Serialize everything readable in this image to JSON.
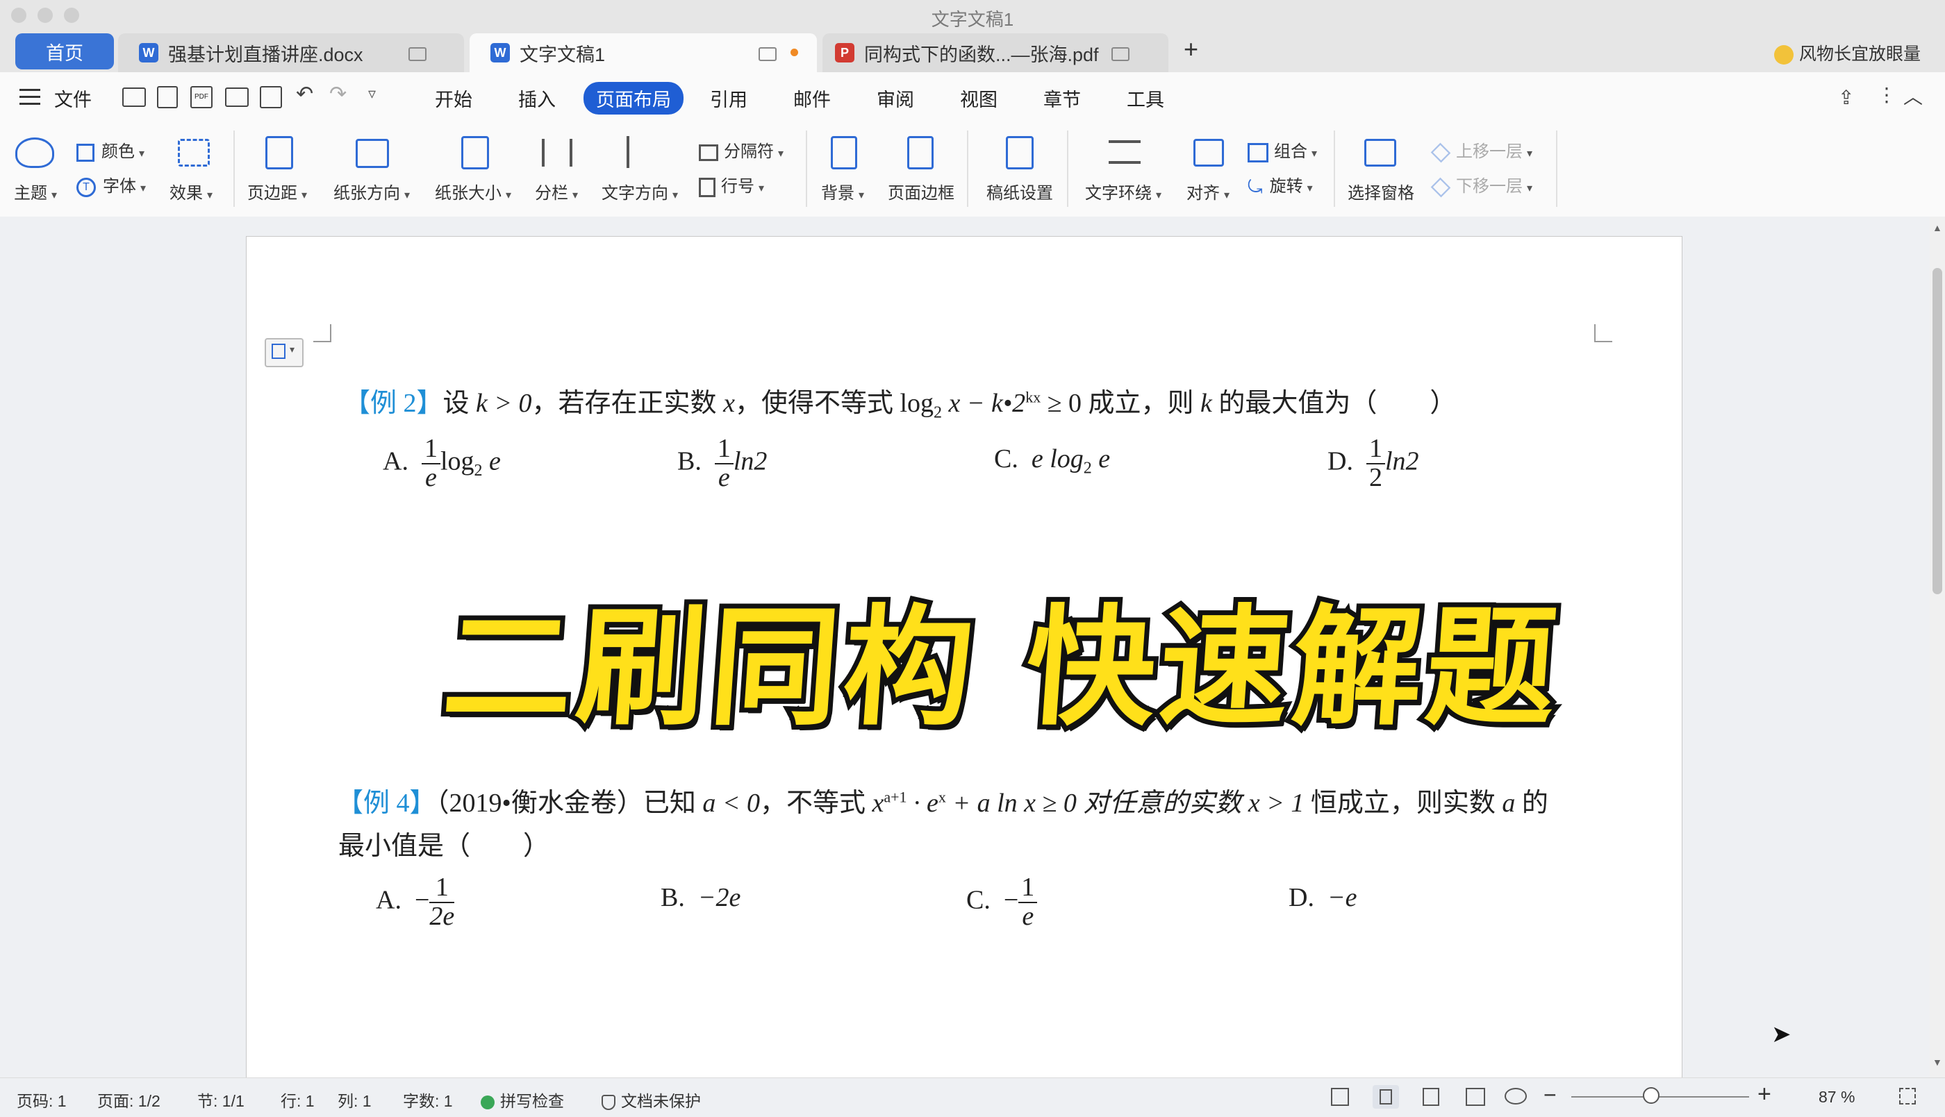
{
  "window": {
    "title": "文字文稿1"
  },
  "tabs": {
    "home": "首页",
    "tab1": "强基计划直播讲座.docx",
    "tab2": "文字文稿1",
    "tab3": "同构式下的函数...—张海.pdf",
    "new_tab": "+",
    "promo": "风物长宜放眼量"
  },
  "menu": {
    "file": "文件",
    "items": [
      "开始",
      "插入",
      "页面布局",
      "引用",
      "邮件",
      "审阅",
      "视图",
      "章节",
      "工具"
    ],
    "active": "页面布局"
  },
  "ribbon": {
    "theme": "主题",
    "color": "颜色",
    "font": "字体",
    "effect": "效果",
    "margins": "页边距",
    "orientation": "纸张方向",
    "size": "纸张大小",
    "columns": "分栏",
    "text_direction": "文字方向",
    "separator": "分隔符",
    "line_number": "行号",
    "background": "背景",
    "page_border": "页面边框",
    "draft_setting": "稿纸设置",
    "wrap_text": "文字环绕",
    "align": "对齐",
    "group": "组合",
    "rotate": "旋转",
    "selection_pane": "选择窗格",
    "bring_forward": "上移一层",
    "send_backward": "下移一层"
  },
  "document": {
    "ex2_tag": "【例 2】",
    "ex2_text_a": "设 ",
    "ex2_text_b": "k > 0",
    "ex2_text_c": "，若存在正实数 ",
    "ex2_text_d": "x",
    "ex2_text_e": "，使得不等式 log",
    "ex2_sub": "2",
    "ex2_text_f": " x − k•2",
    "ex2_sup": "kx",
    "ex2_text_g": " ≥ 0 成立，则 ",
    "ex2_text_h": "k",
    "ex2_text_i": " 的最大值为（　　）",
    "ex2_a_label": "A.",
    "ex2_a_num": "1",
    "ex2_a_den": "e",
    "ex2_a_tail": "log",
    "ex2_a_sub": "2",
    "ex2_a_end": " e",
    "ex2_b_label": "B.",
    "ex2_b_num": "1",
    "ex2_b_den": "e",
    "ex2_b_tail": "ln2",
    "ex2_c_label": "C.",
    "ex2_c_text": "e log",
    "ex2_c_sub": "2",
    "ex2_c_end": " e",
    "ex2_d_label": "D.",
    "ex2_d_num": "1",
    "ex2_d_den": "2",
    "ex2_d_tail": "ln2",
    "banner": "二刷同构 快速解题",
    "ex4_tag": "【例 4】",
    "ex4_text_a": "（2019•衡水金卷）已知 ",
    "ex4_text_b": "a < 0",
    "ex4_text_c": "，不等式 ",
    "ex4_text_d": "x",
    "ex4_sup1": "a+1",
    "ex4_text_e": " · e",
    "ex4_sup2": "x",
    "ex4_text_f": " + a ln x ≥ 0 对任意的实数 ",
    "ex4_text_g": "x > 1",
    "ex4_text_h": " 恒成立，则实数 ",
    "ex4_text_i": "a",
    "ex4_text_j": " 的",
    "ex4_line2": "最小值是（　　）",
    "ex4_a_label": "A.",
    "ex4_a_sign": "−",
    "ex4_a_num": "1",
    "ex4_a_den": "2e",
    "ex4_b_label": "B.",
    "ex4_b_text": "−2e",
    "ex4_c_label": "C.",
    "ex4_c_sign": "−",
    "ex4_c_num": "1",
    "ex4_c_den": "e",
    "ex4_d_label": "D.",
    "ex4_d_text": "−e"
  },
  "status": {
    "page_code": "页码: 1",
    "page": "页面: 1/2",
    "section": "节: 1/1",
    "row": "行: 1",
    "col": "列: 1",
    "words": "字数: 1",
    "spellcheck": "拼写检查",
    "protect": "文档未保护",
    "zoom": "87 %",
    "zoom_level": 0.45
  },
  "colors": {
    "accent": "#2f6bd5",
    "active_tab": "#1f5ed4",
    "banner_fill": "#ffe01a",
    "example_tag": "#1f8fd6"
  }
}
